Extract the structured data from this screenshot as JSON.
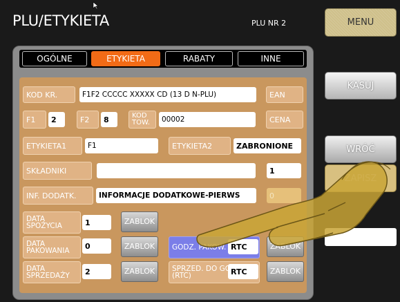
{
  "header": {
    "title": "PLU/ETYKIETA",
    "plu_nr": "PLU NR 2"
  },
  "side": {
    "menu": "MENU",
    "kasuj": "KASUJ",
    "wroc": "WRÓĆ",
    "zapisz": "ZAPISZ"
  },
  "tabs": [
    {
      "label": "OGÓLNE"
    },
    {
      "label": "ETYKIETA"
    },
    {
      "label": "RABATY"
    },
    {
      "label": "INNE"
    }
  ],
  "form": {
    "kod_kr_label": "KOD KR.",
    "kod_kr_value": "F1F2 CCCCC XXXXX CD (13 D N-PLU)",
    "ean_label": "EAN",
    "f1_label": "F1",
    "f1_value": "2",
    "f2_label": "F2",
    "f2_value": "8",
    "kod_tow_label": "KOD TOW.",
    "kod_tow_value": "00002",
    "cena_label": "CENA",
    "etykieta1_label": "ETYKIETA1",
    "etykieta1_value": "F1",
    "etykieta2_label": "ETYKIETA2",
    "etykieta2_value": "ZABRONIONE",
    "skladniki_label": "SKŁADNIKI",
    "skladniki_value": "",
    "skladniki_num": "1",
    "inf_label": "INF. DODATK.",
    "inf_value": "INFORMACJE DODATKOWE-PIERWS",
    "inf_num": "0",
    "data_spozycia_label": "DATA SPOŻYCIA",
    "data_spozycia_value": "1",
    "data_pakowania_label": "DATA PAKOWANIA",
    "data_pakowania_value": "0",
    "data_sprzedazy_label": "DATA SPRZEDAŻY",
    "data_sprzedazy_value": "2",
    "zablok": "ZABLOK",
    "godz_pakow_label": "GODZ. PAKOW.",
    "godz_pakow_value": "RTC",
    "sprzed_label": "SPRZED. DO GODZ.(RTC)",
    "sprzed_value": "RTC"
  },
  "colors": {
    "accent": "#f26b16",
    "form_bg": "#c9975e",
    "menu_bg": "#cfc08b",
    "highlight": "#7b7ee8"
  }
}
